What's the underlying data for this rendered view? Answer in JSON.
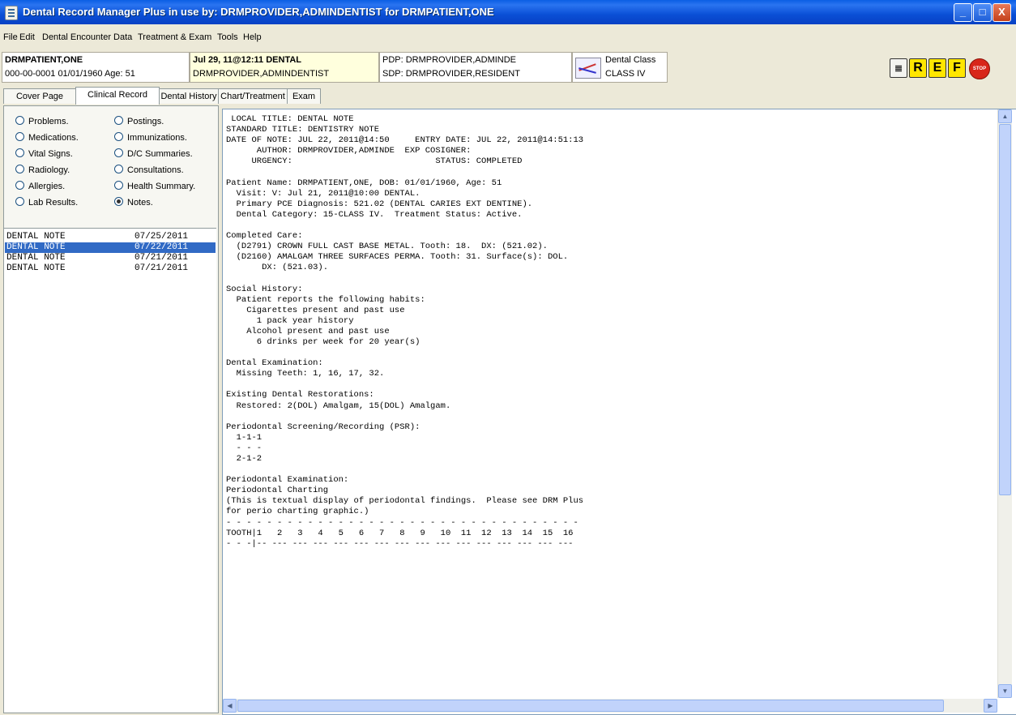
{
  "window": {
    "title": "Dental Record Manager Plus in use by: DRMPROVIDER,ADMINDENTIST for DRMPATIENT,ONE",
    "controls": {
      "minimize": "_",
      "maximize": "□",
      "close": "X"
    }
  },
  "menu": [
    "File",
    "Edit",
    "Dental Encounter Data",
    "Treatment & Exam",
    "Tools",
    "Help"
  ],
  "patient": {
    "name": "DRMPATIENT,ONE",
    "details": "000-00-0001   01/01/1960 Age:  51"
  },
  "visit": {
    "date": "Jul 29, 11@12:11 DENTAL",
    "provider": "DRMPROVIDER,ADMINDENTIST"
  },
  "providers": {
    "pdp": "PDP: DRMPROVIDER,ADMINDE",
    "sdp": "SDP: DRMPROVIDER,RESIDENT"
  },
  "dental_class": {
    "label": "Dental Class",
    "value": "CLASS IV"
  },
  "toolbar": {
    "notes_icon": "notes-icon",
    "r": "R",
    "e": "E",
    "f": "F",
    "stop": "STOP"
  },
  "tabs": [
    "Cover Page",
    "Clinical Record",
    "Dental History",
    "Chart/Treatment",
    "Exam"
  ],
  "active_tab": "Clinical Record",
  "record_types": {
    "left": [
      "Problems.",
      "Medications.",
      "Vital Signs.",
      "Radiology.",
      "Allergies.",
      "Lab Results."
    ],
    "right": [
      "Postings.",
      "Immunizations.",
      "D/C Summaries.",
      "Consultations.",
      "Health Summary.",
      "Notes."
    ],
    "selected": "Notes."
  },
  "notes": [
    {
      "title": "DENTAL NOTE",
      "date": "07/25/2011"
    },
    {
      "title": "DENTAL NOTE",
      "date": "07/22/2011"
    },
    {
      "title": "DENTAL NOTE",
      "date": "07/21/2011"
    },
    {
      "title": "DENTAL NOTE",
      "date": "07/21/2011"
    }
  ],
  "selected_note_index": 1,
  "note_text": " LOCAL TITLE: DENTAL NOTE\nSTANDARD TITLE: DENTISTRY NOTE\nDATE OF NOTE: JUL 22, 2011@14:50     ENTRY DATE: JUL 22, 2011@14:51:13\n      AUTHOR: DRMPROVIDER,ADMINDE  EXP COSIGNER:\n     URGENCY:                            STATUS: COMPLETED\n\nPatient Name: DRMPATIENT,ONE, DOB: 01/01/1960, Age: 51\n  Visit: V: Jul 21, 2011@10:00 DENTAL.\n  Primary PCE Diagnosis: 521.02 (DENTAL CARIES EXT DENTINE).\n  Dental Category: 15-CLASS IV.  Treatment Status: Active.\n\nCompleted Care:\n  (D2791) CROWN FULL CAST BASE METAL. Tooth: 18.  DX: (521.02).\n  (D2160) AMALGAM THREE SURFACES PERMA. Tooth: 31. Surface(s): DOL.\n       DX: (521.03).\n\nSocial History:\n  Patient reports the following habits:\n    Cigarettes present and past use\n      1 pack year history\n    Alcohol present and past use\n      6 drinks per week for 20 year(s)\n\nDental Examination:\n  Missing Teeth: 1, 16, 17, 32.\n\nExisting Dental Restorations:\n  Restored: 2(DOL) Amalgam, 15(DOL) Amalgam.\n\nPeriodontal Screening/Recording (PSR):\n  1-1-1\n  - - -\n  2-1-2\n\nPeriodontal Examination:\nPeriodontal Charting\n(This is textual display of periodontal findings.  Please see DRM Plus\nfor perio charting graphic.)\n- - - - - - - - - - - - - - - - - - - - - - - - - - - - - - - - - - -\nTOOTH|1   2   3   4   5   6   7   8   9   10  11  12  13  14  15  16\n- - -|-- --- --- --- --- --- --- --- --- --- --- --- --- --- --- ---"
}
